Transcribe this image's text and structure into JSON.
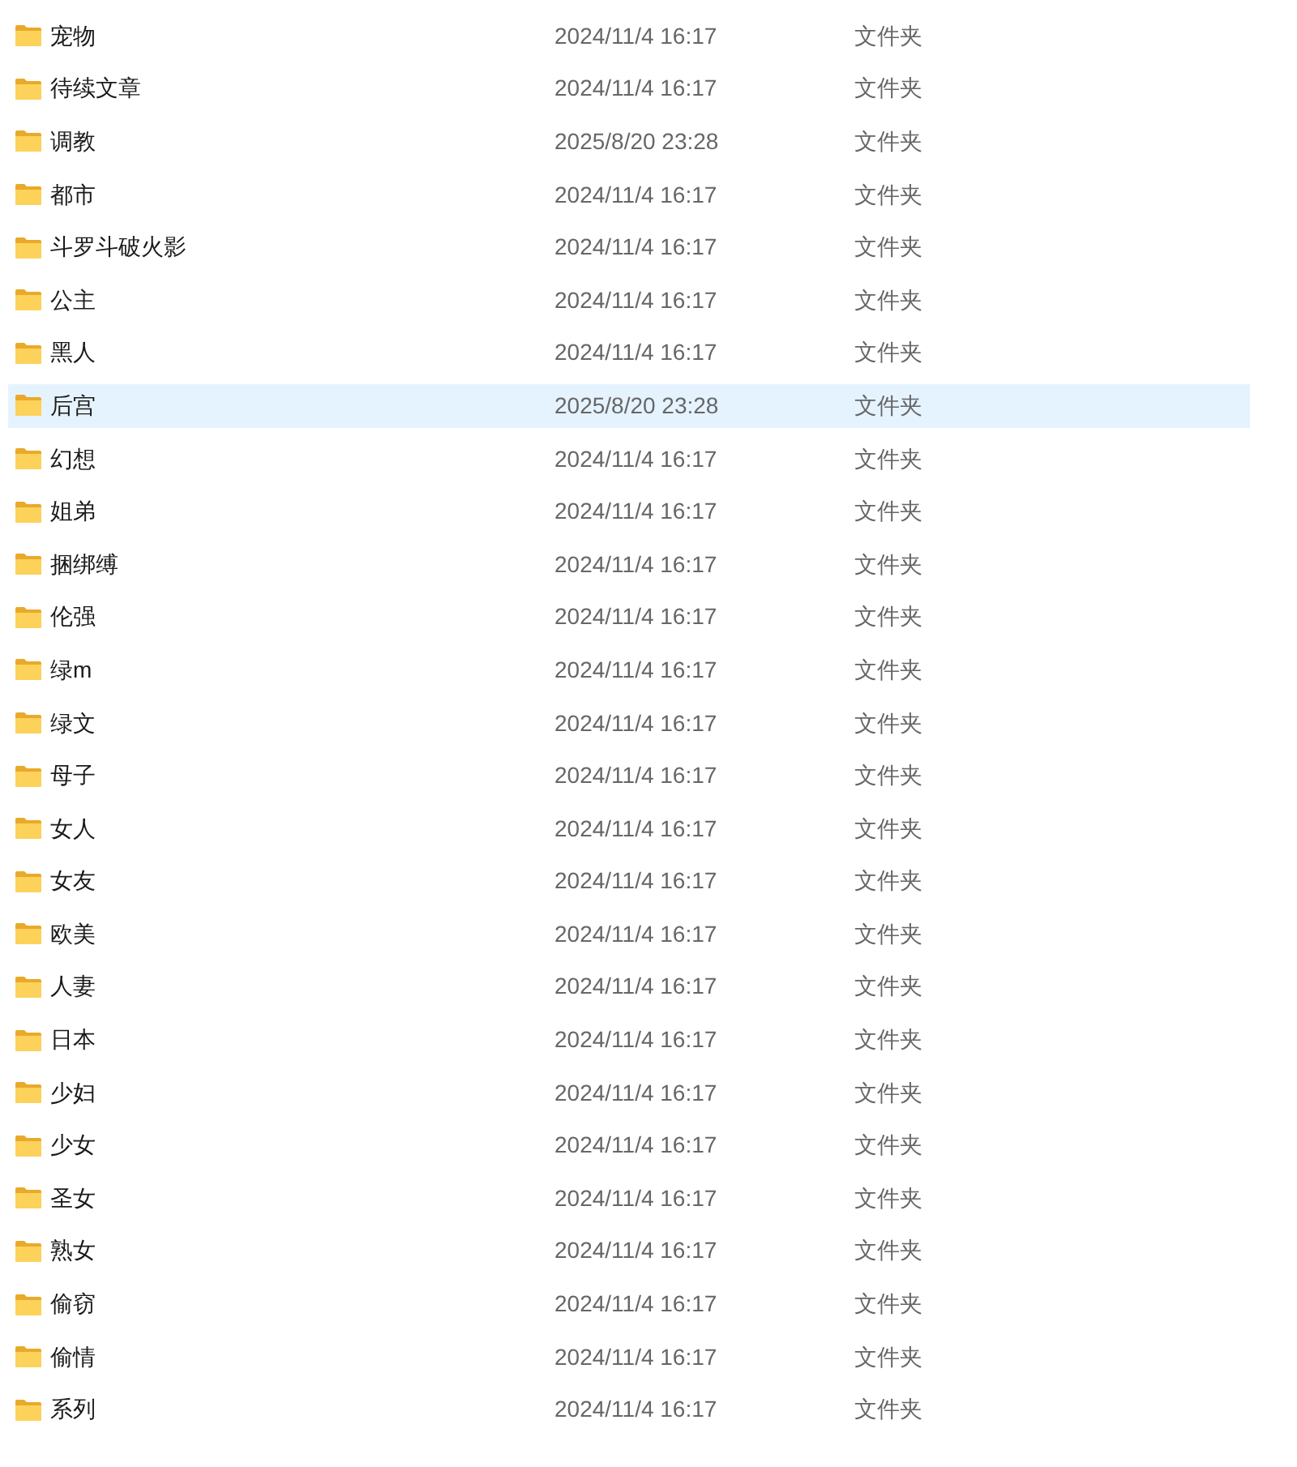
{
  "files": [
    {
      "name": "宠物",
      "modified": "2024/11/4 16:17",
      "type": "文件夹",
      "selected": false
    },
    {
      "name": "待续文章",
      "modified": "2024/11/4 16:17",
      "type": "文件夹",
      "selected": false
    },
    {
      "name": "调教",
      "modified": "2025/8/20 23:28",
      "type": "文件夹",
      "selected": false
    },
    {
      "name": "都市",
      "modified": "2024/11/4 16:17",
      "type": "文件夹",
      "selected": false
    },
    {
      "name": "斗罗斗破火影",
      "modified": "2024/11/4 16:17",
      "type": "文件夹",
      "selected": false
    },
    {
      "name": "公主",
      "modified": "2024/11/4 16:17",
      "type": "文件夹",
      "selected": false
    },
    {
      "name": "黑人",
      "modified": "2024/11/4 16:17",
      "type": "文件夹",
      "selected": false
    },
    {
      "name": "后宫",
      "modified": "2025/8/20 23:28",
      "type": "文件夹",
      "selected": true
    },
    {
      "name": "幻想",
      "modified": "2024/11/4 16:17",
      "type": "文件夹",
      "selected": false
    },
    {
      "name": "姐弟",
      "modified": "2024/11/4 16:17",
      "type": "文件夹",
      "selected": false
    },
    {
      "name": "捆绑缚",
      "modified": "2024/11/4 16:17",
      "type": "文件夹",
      "selected": false
    },
    {
      "name": "伦强",
      "modified": "2024/11/4 16:17",
      "type": "文件夹",
      "selected": false
    },
    {
      "name": "绿m",
      "modified": "2024/11/4 16:17",
      "type": "文件夹",
      "selected": false
    },
    {
      "name": "绿文",
      "modified": "2024/11/4 16:17",
      "type": "文件夹",
      "selected": false
    },
    {
      "name": "母子",
      "modified": "2024/11/4 16:17",
      "type": "文件夹",
      "selected": false
    },
    {
      "name": "女人",
      "modified": "2024/11/4 16:17",
      "type": "文件夹",
      "selected": false
    },
    {
      "name": "女友",
      "modified": "2024/11/4 16:17",
      "type": "文件夹",
      "selected": false
    },
    {
      "name": "欧美",
      "modified": "2024/11/4 16:17",
      "type": "文件夹",
      "selected": false
    },
    {
      "name": "人妻",
      "modified": "2024/11/4 16:17",
      "type": "文件夹",
      "selected": false
    },
    {
      "name": "日本",
      "modified": "2024/11/4 16:17",
      "type": "文件夹",
      "selected": false
    },
    {
      "name": "少妇",
      "modified": "2024/11/4 16:17",
      "type": "文件夹",
      "selected": false
    },
    {
      "name": "少女",
      "modified": "2024/11/4 16:17",
      "type": "文件夹",
      "selected": false
    },
    {
      "name": "圣女",
      "modified": "2024/11/4 16:17",
      "type": "文件夹",
      "selected": false
    },
    {
      "name": "熟女",
      "modified": "2024/11/4 16:17",
      "type": "文件夹",
      "selected": false
    },
    {
      "name": "偷窃",
      "modified": "2024/11/4 16:17",
      "type": "文件夹",
      "selected": false
    },
    {
      "name": "偷情",
      "modified": "2024/11/4 16:17",
      "type": "文件夹",
      "selected": false
    },
    {
      "name": "系列",
      "modified": "2024/11/4 16:17",
      "type": "文件夹",
      "selected": false
    }
  ]
}
